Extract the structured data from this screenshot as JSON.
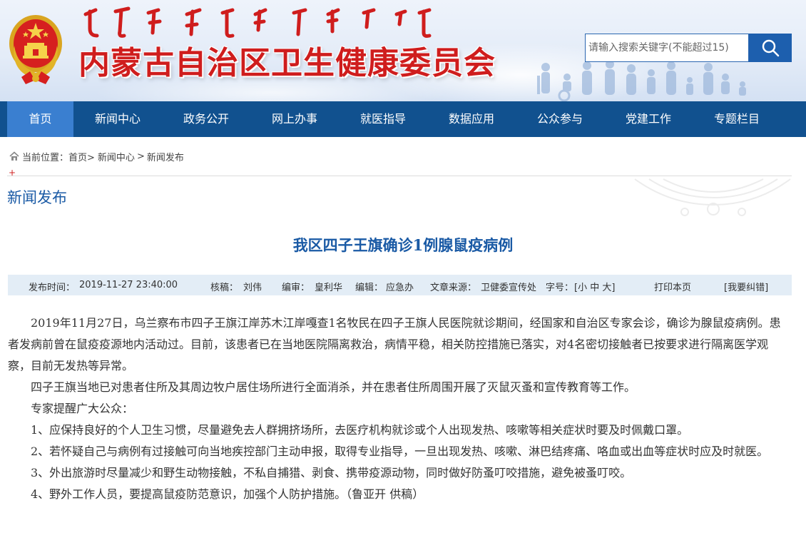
{
  "header": {
    "site_title": "内蒙古自治区卫生健康委员会",
    "accent_red": "#cf1d1d",
    "search_placeholder": "请输入搜索关键字(不能超过15)"
  },
  "nav": {
    "items": [
      "首页",
      "新闻中心",
      "政务公开",
      "网上办事",
      "就医指导",
      "数据应用",
      "公众参与",
      "党建工作",
      "专题栏目"
    ],
    "active_index": 0,
    "bg_color": "#11518f",
    "active_color": "#3a7fd0"
  },
  "breadcrumb": {
    "label": "当前位置：",
    "items": [
      "首页>",
      "新闻中心",
      ">",
      "新闻发布"
    ]
  },
  "section": {
    "title": "新闻发布"
  },
  "article": {
    "title": "我区四子王旗确诊1例腺鼠疫病例",
    "meta": {
      "publish_label": "发布时间：",
      "publish_time": "2019-11-27 23:40:00",
      "reviewer_label": "核稿：",
      "reviewer": "刘伟",
      "editor_label": "编审：",
      "editor": "皇利华",
      "editor2_label": "编辑：",
      "editor2": "应急办",
      "source_label": "文章来源：",
      "source": "卫健委宣传处",
      "fontsize_label": "字号：",
      "fontsize_options": "[小 中 大]",
      "print": "打印本页",
      "correct": "[我要纠错]"
    },
    "paragraphs": [
      "2019年11月27日，乌兰察布市四子王旗江岸苏木江岸嘎查1名牧民在四子王旗人民医院就诊期间，经国家和自治区专家会诊，确诊为腺鼠疫病例。患者发病前曾在鼠疫疫源地内活动过。目前，该患者已在当地医院隔离救治，病情平稳，相关防控措施已落实，对4名密切接触者已按要求进行隔离医学观察，目前无发热等异常。",
      "四子王旗当地已对患者住所及其周边牧户居住场所进行全面消杀，并在患者住所周围开展了灭鼠灭蚤和宣传教育等工作。",
      "专家提醒广大公众：",
      "1、应保持良好的个人卫生习惯，尽量避免去人群拥挤场所，去医疗机构就诊或个人出现发热、咳嗽等相关症状时要及时佩戴口罩。",
      "2、若怀疑自己与病例有过接触可向当地疾控部门主动申报，取得专业指导，一旦出现发热、咳嗽、淋巴结疼痛、咯血或出血等症状时应及时就医。",
      "3、外出旅游时尽量减少和野生动物接触，不私自捕猎、剥食、携带疫源动物，同时做好防蚤叮咬措施，避免被蚤叮咬。",
      "4、野外工作人员，要提高鼠疫防范意识，加强个人防护措施。（鲁亚开  供稿）"
    ]
  }
}
